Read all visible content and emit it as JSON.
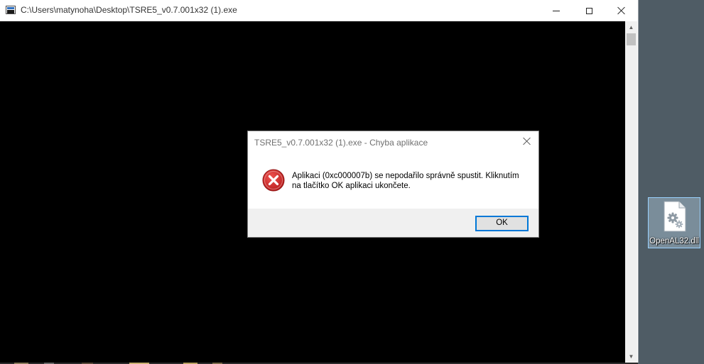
{
  "console_window": {
    "title": "C:\\Users\\matynoha\\Desktop\\TSRE5_v0.7.001x32 (1).exe",
    "icon": "console-app-icon",
    "controls": [
      "minimize-icon",
      "maximize-icon",
      "close-icon"
    ]
  },
  "error_dialog": {
    "title": "TSRE5_v0.7.001x32 (1).exe - Chyba aplikace",
    "icon": "error-icon",
    "message_line1": "Aplikaci (0xc000007b) se nepodařilo správně spustit. Kliknutím",
    "message_line2": "na tlačítko OK aplikaci ukončete.",
    "ok_label": "OK",
    "colors": {
      "error_red": "#d32f2f",
      "button_border": "#0078d7"
    }
  },
  "desktop": {
    "file_label": "OpenAL32.dll",
    "file_icon": "dll-settings-file-icon"
  }
}
